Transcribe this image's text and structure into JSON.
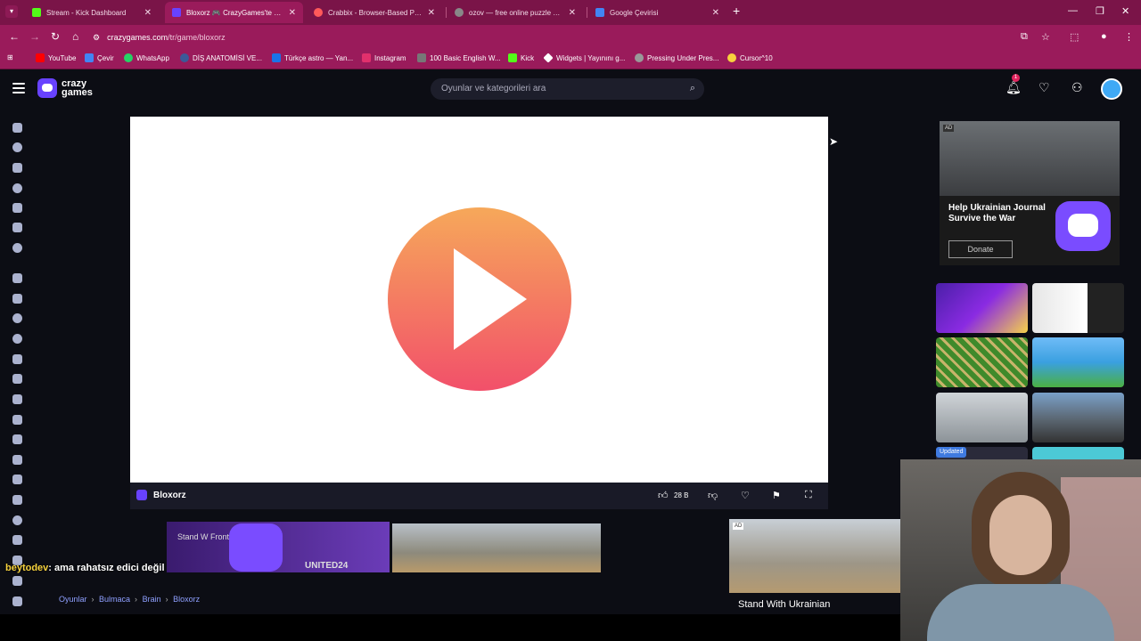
{
  "browser": {
    "tabs": [
      {
        "title": "Stream - Kick Dashboard",
        "color": "#53fc18"
      },
      {
        "title": "Bloxorz 🎮 CrazyGames'te oyn",
        "color": "#6842ff"
      },
      {
        "title": "Crabbix - Browser-Based Puzzl",
        "color": "#ff5a5a"
      },
      {
        "title": "ozov — free online puzzle gam",
        "color": "#888888"
      },
      {
        "title": "Google Çevirisi",
        "color": "#4285f4"
      }
    ],
    "url_domain": "crazygames.com",
    "url_path": "/tr/game/bloxorz",
    "bookmarks": [
      {
        "label": "YouTube",
        "color": "#ff0000"
      },
      {
        "label": "Çevir",
        "color": "#4285f4"
      },
      {
        "label": "WhatsApp",
        "color": "#25d366"
      },
      {
        "label": "DİŞ ANATOMİSİ VE...",
        "color": "#3b5998"
      },
      {
        "label": "Türkçe astro — Yan...",
        "color": "#1a73e8"
      },
      {
        "label": "Instagram",
        "color": "#e1306c"
      },
      {
        "label": "100 Basic English W...",
        "color": "#777777"
      },
      {
        "label": "Kick",
        "color": "#53fc18"
      },
      {
        "label": "Widgets | Yayınını g...",
        "color": "#ffffff"
      },
      {
        "label": "Pressing Under Pres...",
        "color": "#999999"
      },
      {
        "label": "Cursor^10",
        "color": "#f7d23e"
      }
    ]
  },
  "site": {
    "logo_line1": "crazy",
    "logo_line2": "games",
    "search_placeholder": "Oyunlar ve kategorileri ara",
    "notification_count": "1"
  },
  "game": {
    "title": "Bloxorz",
    "likes": "28 B"
  },
  "ads": {
    "top_label": "AD",
    "top_headline": "Help Ukrainian Journal Survive the War",
    "top_button": "Donate",
    "banner_text": "Stand W Frontline",
    "banner_brand": "UNITED24",
    "card_label": "AD",
    "card_title": "Stand With Ukrainian"
  },
  "sidebar_thumbs": {
    "updated_badge": "Updated"
  },
  "chat": {
    "user": "beytodev",
    "message": ": ama rahatsız edici değil"
  },
  "breadcrumb": [
    "Oyunlar",
    "Bulmaca",
    "Brain",
    "Bloxorz"
  ]
}
